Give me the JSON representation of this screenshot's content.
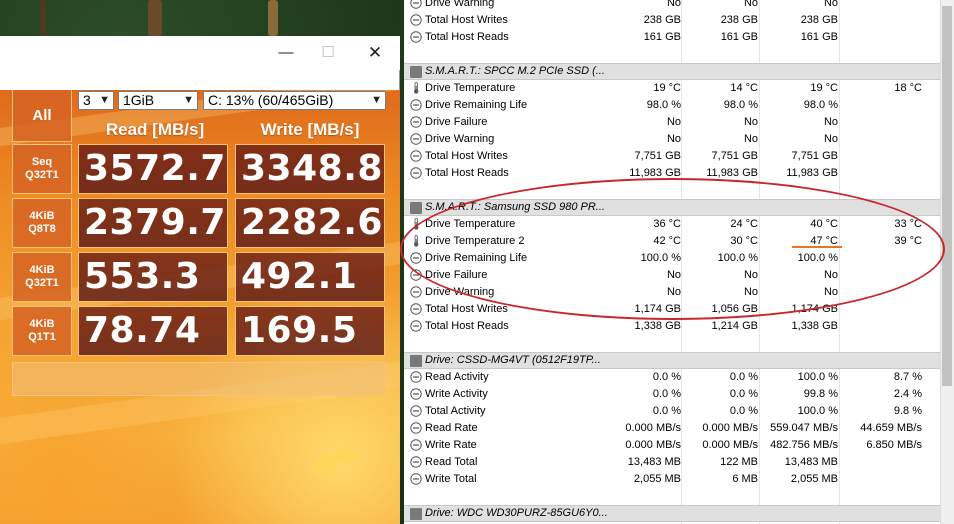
{
  "cdm": {
    "window_controls": {
      "minimize": "—",
      "maximize": "☐",
      "close": "✕"
    },
    "all_button": "All",
    "count_select": "3",
    "size_select": "1GiB",
    "drive_select": "C: 13% (60/465GiB)",
    "read_header": "Read [MB/s]",
    "write_header": "Write [MB/s]",
    "rows": [
      {
        "line1": "Seq",
        "line2": "Q32T1",
        "read": "3572.7",
        "write": "3348.8"
      },
      {
        "line1": "4KiB",
        "line2": "Q8T8",
        "read": "2379.7",
        "write": "2282.6"
      },
      {
        "line1": "4KiB",
        "line2": "Q32T1",
        "read": "553.3",
        "write": "492.1"
      },
      {
        "line1": "4KiB",
        "line2": "Q1T1",
        "read": "78.74",
        "write": "169.5"
      }
    ]
  },
  "hwinfo": {
    "top_rows": [
      {
        "name": "Drive Warning",
        "c1": "No",
        "c2": "No",
        "c3": "No",
        "c4": ""
      },
      {
        "name": "Total Host Writes",
        "c1": "238 GB",
        "c2": "238 GB",
        "c3": "238 GB",
        "c4": ""
      },
      {
        "name": "Total Host Reads",
        "c1": "161 GB",
        "c2": "161 GB",
        "c3": "161 GB",
        "c4": ""
      }
    ],
    "section1": {
      "title": "S.M.A.R.T.: SPCC M.2 PCIe SSD (...",
      "rows": [
        {
          "name": "Drive Temperature",
          "c1": "19 °C",
          "c2": "14 °C",
          "c3": "19 °C",
          "c4": "18 °C"
        },
        {
          "name": "Drive Remaining Life",
          "c1": "98.0 %",
          "c2": "98.0 %",
          "c3": "98.0 %",
          "c4": ""
        },
        {
          "name": "Drive Failure",
          "c1": "No",
          "c2": "No",
          "c3": "No",
          "c4": ""
        },
        {
          "name": "Drive Warning",
          "c1": "No",
          "c2": "No",
          "c3": "No",
          "c4": ""
        },
        {
          "name": "Total Host Writes",
          "c1": "7,751 GB",
          "c2": "7,751 GB",
          "c3": "7,751 GB",
          "c4": ""
        },
        {
          "name": "Total Host Reads",
          "c1": "11,983 GB",
          "c2": "11,983 GB",
          "c3": "11,983 GB",
          "c4": ""
        }
      ]
    },
    "section2": {
      "title": "S.M.A.R.T.: Samsung SSD 980 PR...",
      "rows": [
        {
          "name": "Drive Temperature",
          "c1": "36 °C",
          "c2": "24 °C",
          "c3": "40 °C",
          "c4": "33 °C"
        },
        {
          "name": "Drive Temperature 2",
          "c1": "42 °C",
          "c2": "30 °C",
          "c3": "47 °C",
          "c4": "39 °C"
        },
        {
          "name": "Drive Remaining Life",
          "c1": "100.0 %",
          "c2": "100.0 %",
          "c3": "100.0 %",
          "c4": ""
        },
        {
          "name": "Drive Failure",
          "c1": "No",
          "c2": "No",
          "c3": "No",
          "c4": ""
        },
        {
          "name": "Drive Warning",
          "c1": "No",
          "c2": "No",
          "c3": "No",
          "c4": ""
        },
        {
          "name": "Total Host Writes",
          "c1": "1,174 GB",
          "c2": "1,056 GB",
          "c3": "1,174 GB",
          "c4": ""
        },
        {
          "name": "Total Host Reads",
          "c1": "1,338 GB",
          "c2": "1,214 GB",
          "c3": "1,338 GB",
          "c4": ""
        }
      ]
    },
    "section3": {
      "title": "Drive: CSSD-MG4VT (0512F19TP...",
      "rows": [
        {
          "name": "Read Activity",
          "c1": "0.0 %",
          "c2": "0.0 %",
          "c3": "100.0 %",
          "c4": "8.7 %"
        },
        {
          "name": "Write Activity",
          "c1": "0.0 %",
          "c2": "0.0 %",
          "c3": "99.8 %",
          "c4": "2.4 %"
        },
        {
          "name": "Total Activity",
          "c1": "0.0 %",
          "c2": "0.0 %",
          "c3": "100.0 %",
          "c4": "9.8 %"
        },
        {
          "name": "Read Rate",
          "c1": "0.000 MB/s",
          "c2": "0.000 MB/s",
          "c3": "559.047 MB/s",
          "c4": "44.659 MB/s"
        },
        {
          "name": "Write Rate",
          "c1": "0.000 MB/s",
          "c2": "0.000 MB/s",
          "c3": "482.756 MB/s",
          "c4": "6.850 MB/s"
        },
        {
          "name": "Read Total",
          "c1": "13,483 MB",
          "c2": "122 MB",
          "c3": "13,483 MB",
          "c4": ""
        },
        {
          "name": "Write Total",
          "c1": "2,055 MB",
          "c2": "6 MB",
          "c3": "2,055 MB",
          "c4": ""
        }
      ]
    },
    "section4": {
      "title": "Drive: WDC WD30PURZ-85GU6Y0..."
    }
  }
}
